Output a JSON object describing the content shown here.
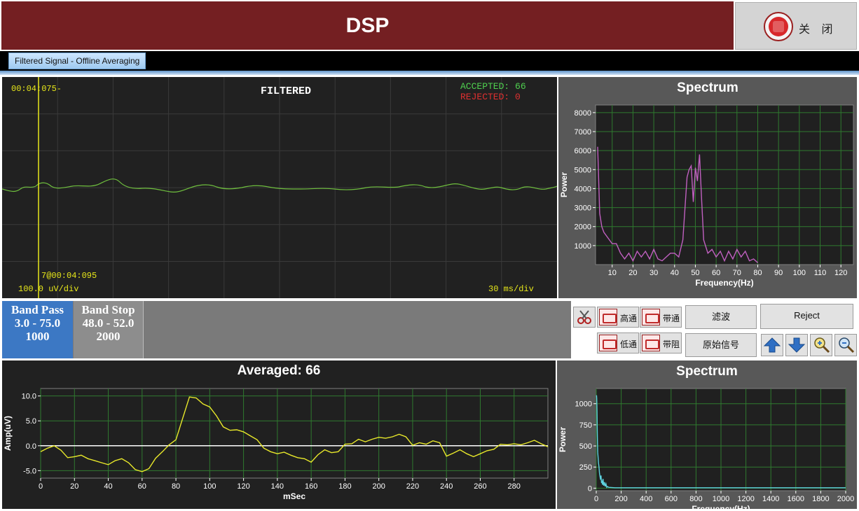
{
  "app": {
    "title": "DSP",
    "close_label": "关 闭"
  },
  "tabs": [
    {
      "label": "Filtered Signal - Offline Averaging",
      "active": true
    }
  ],
  "filtered_view": {
    "timestamp": "00:04:075-",
    "title": "FILTERED",
    "accepted_label": "ACCEPTED:",
    "accepted_value": "66",
    "rejected_label": "REJECTED:",
    "rejected_value": "0",
    "marker_label": "7@00:04:095",
    "vertical_scale": "100.0 uV/div",
    "horizontal_scale": "30 ms/div",
    "colors": {
      "trace": "#6fbf3e",
      "cursor": "#e8e81a",
      "accepted": "#4fd04f",
      "rejected": "#e03030"
    }
  },
  "spectrum_top": {
    "title": "Spectrum",
    "chart_data": {
      "type": "line",
      "xlabel": "Frequency(Hz)",
      "ylabel": "Power",
      "xlim": [
        2,
        126
      ],
      "ylim": [
        0,
        8400
      ],
      "xticks": [
        10,
        20,
        30,
        40,
        50,
        60,
        70,
        80,
        90,
        100,
        110,
        120
      ],
      "yticks": [
        1000,
        2000,
        3000,
        4000,
        5000,
        6000,
        7000,
        8000
      ],
      "color": "#c060c0",
      "x": [
        3,
        4,
        5,
        6,
        8,
        10,
        12,
        14,
        16,
        18,
        20,
        22,
        24,
        26,
        28,
        30,
        32,
        34,
        36,
        38,
        40,
        42,
        44,
        46,
        47,
        48,
        49,
        50,
        51,
        52,
        53,
        54,
        56,
        58,
        60,
        62,
        64,
        66,
        68,
        70,
        72,
        74,
        76,
        78,
        80
      ],
      "y": [
        6200,
        2700,
        2000,
        1700,
        1400,
        1100,
        1100,
        600,
        300,
        600,
        200,
        700,
        400,
        700,
        300,
        800,
        300,
        200,
        400,
        600,
        600,
        400,
        1300,
        4600,
        5000,
        5200,
        3300,
        5100,
        4400,
        5800,
        3400,
        1300,
        600,
        800,
        400,
        700,
        200,
        700,
        300,
        800,
        400,
        700,
        200,
        300,
        100
      ]
    }
  },
  "filters": [
    {
      "name": "Band Pass",
      "range": "3.0 - 75.0",
      "order": "1000",
      "selected": true
    },
    {
      "name": "Band Stop",
      "range": "48.0 - 52.0",
      "order": "2000",
      "selected": false
    }
  ],
  "toolbar": {
    "delete_icon": "scissors-icon",
    "highpass": "高通",
    "bandpass": "带通",
    "lowpass": "低通",
    "bandstop": "带阻",
    "filter": "滤波",
    "reject": "Reject",
    "raw_signal": "原始信号"
  },
  "averaged": {
    "title": "Averaged: 66",
    "chart_data": {
      "type": "line",
      "xlabel": "mSec",
      "ylabel": "Amp(uV)",
      "xlim": [
        0,
        300
      ],
      "ylim": [
        -6.5,
        11.5
      ],
      "xticks": [
        0,
        20,
        40,
        60,
        80,
        100,
        120,
        140,
        160,
        180,
        200,
        220,
        240,
        260,
        280
      ],
      "yticks": [
        -5.0,
        0.0,
        5.0,
        10.0
      ],
      "color": "#e8e82a",
      "x": [
        0,
        4,
        8,
        12,
        16,
        20,
        24,
        28,
        32,
        36,
        40,
        44,
        48,
        52,
        56,
        60,
        64,
        68,
        72,
        76,
        80,
        84,
        88,
        92,
        96,
        100,
        104,
        108,
        112,
        116,
        120,
        124,
        128,
        132,
        136,
        140,
        144,
        148,
        152,
        156,
        160,
        164,
        168,
        172,
        176,
        180,
        184,
        188,
        192,
        196,
        200,
        204,
        208,
        212,
        216,
        220,
        224,
        228,
        232,
        236,
        240,
        244,
        248,
        252,
        256,
        260,
        264,
        268,
        272,
        276,
        280,
        284,
        288,
        292,
        296,
        300
      ],
      "y": [
        -1.2,
        -0.5,
        0.0,
        -0.9,
        -2.4,
        -2.2,
        -1.9,
        -2.6,
        -3.0,
        -3.4,
        -3.8,
        -3.0,
        -2.6,
        -3.4,
        -4.8,
        -5.2,
        -4.6,
        -2.5,
        -1.2,
        0.2,
        1.2,
        5.5,
        9.8,
        9.6,
        8.4,
        7.8,
        6.0,
        3.8,
        3.1,
        3.2,
        2.8,
        2.0,
        1.2,
        -0.5,
        -1.2,
        -1.6,
        -1.3,
        -1.9,
        -2.4,
        -2.6,
        -3.3,
        -1.8,
        -0.8,
        -1.4,
        -1.2,
        0.3,
        0.4,
        1.3,
        0.8,
        1.3,
        1.7,
        1.5,
        1.8,
        2.3,
        1.8,
        0.1,
        0.6,
        0.3,
        1.0,
        0.6,
        -2.1,
        -1.5,
        -0.8,
        -1.6,
        -2.2,
        -1.6,
        -1.0,
        -0.7,
        0.3,
        0.2,
        0.4,
        0.2,
        0.6,
        1.1,
        0.4,
        -0.2
      ]
    }
  },
  "spectrum_bottom": {
    "title": "Spectrum",
    "chart_data": {
      "type": "line",
      "xlabel": "Frequency(Hz)",
      "ylabel": "Power",
      "xlim": [
        0,
        2000
      ],
      "ylim": [
        -30,
        1180
      ],
      "xticks": [
        0,
        200,
        400,
        600,
        800,
        1000,
        1200,
        1400,
        1600,
        1800,
        2000
      ],
      "yticks": [
        0,
        250,
        500,
        750,
        1000
      ],
      "color": "#5fd3e0",
      "x": [
        2,
        4,
        6,
        8,
        10,
        12,
        14,
        18,
        22,
        26,
        30,
        34,
        38,
        42,
        46,
        50,
        54,
        60,
        66,
        72,
        78,
        84,
        90,
        100,
        150,
        300,
        600,
        1000,
        1500,
        2000
      ],
      "y": [
        1100,
        1060,
        900,
        700,
        520,
        420,
        380,
        300,
        250,
        180,
        140,
        100,
        150,
        60,
        90,
        40,
        110,
        30,
        70,
        20,
        50,
        10,
        20,
        10,
        5,
        5,
        5,
        5,
        5,
        5
      ]
    }
  }
}
